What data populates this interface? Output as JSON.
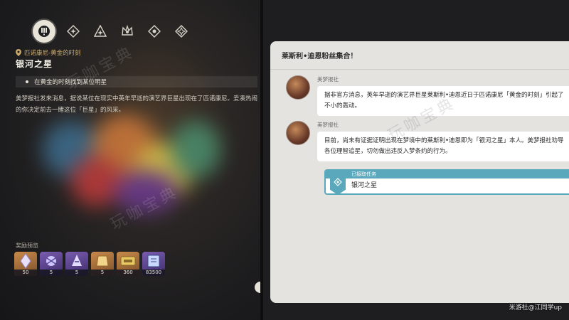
{
  "left": {
    "tabs": [
      {
        "icon": "quest-alert-icon",
        "active": true
      },
      {
        "icon": "diamond-star-icon"
      },
      {
        "icon": "triangle-star-icon"
      },
      {
        "icon": "crown-star-icon"
      },
      {
        "icon": "diamond-dot-icon"
      },
      {
        "icon": "diamond-star-icon-2"
      }
    ],
    "location": "匹诺康尼-黄金的时刻",
    "title": "银河之星",
    "objective": "在黄金的时刻找到某位明星",
    "description": "美梦报社发来消息，据说某位在现实中英年早逝的演艺界巨星出现在了匹诺康尼。爱凑热闹的你决定前去一睹这位「巨星」的风采。",
    "rewards_label": "奖励预览",
    "rewards": [
      {
        "count": "50",
        "icon": "stellar-jade-icon"
      },
      {
        "count": "5",
        "icon": "material-icon"
      },
      {
        "count": "5",
        "icon": "purple-material-icon"
      },
      {
        "count": "5",
        "icon": "gold-material-icon"
      },
      {
        "count": "360",
        "icon": "credit-ticket-icon"
      },
      {
        "count": "83500",
        "icon": "exp-book-icon"
      }
    ],
    "watermark": "玩咖宝典"
  },
  "right": {
    "chat_title": "莱斯利•迪恩粉丝集合！",
    "messages": [
      {
        "sender": "美梦报社",
        "text": "据非官方消息，英年早逝的演艺界巨星莱斯利•迪恩近日于匹诺康尼「黄金的时刻」引起了不小的轰动。"
      },
      {
        "sender": "美梦报社",
        "text": "目前，尚未有证据证明出现在梦境中的莱斯利•迪恩即为「银河之星」本人。美梦报社劝导各位理智追星，切勿做出违反入梦条约的行为。"
      }
    ],
    "task": {
      "label": "已接取任务",
      "name": "银河之星"
    },
    "watermark": "玩咖宝典"
  },
  "credit": "米游社@江同学up",
  "colors": {
    "accent_teal": "#5aa8bc",
    "gold_text": "#c9a86a"
  }
}
